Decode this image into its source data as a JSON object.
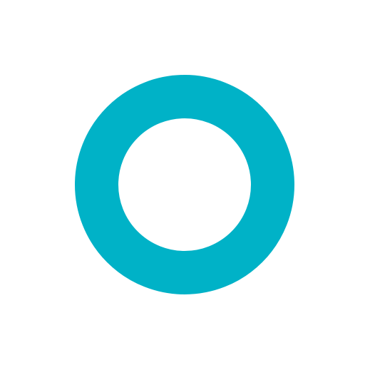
{
  "icon": {
    "name": "ring-icon",
    "ring_color": "#00B2C7",
    "background_color": "#FFFFFF"
  }
}
